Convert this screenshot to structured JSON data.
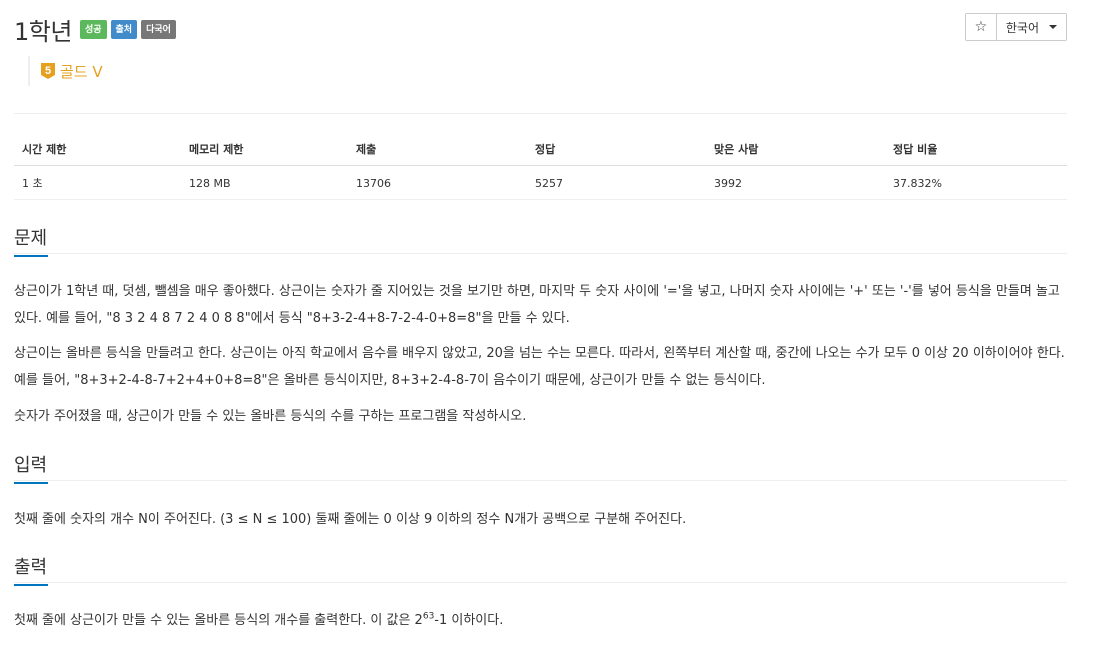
{
  "problem": {
    "title": "1학년",
    "labels": [
      "성공",
      "출처",
      "다국어"
    ],
    "tier_number": "5",
    "tier": "골드 V"
  },
  "controls": {
    "star": "☆",
    "language": "한국어"
  },
  "info_table": {
    "headers": [
      "시간 제한",
      "메모리 제한",
      "제출",
      "정답",
      "맞은 사람",
      "정답 비율"
    ],
    "row": [
      "1 초",
      "128 MB",
      "13706",
      "5257",
      "3992",
      "37.832%"
    ]
  },
  "sections": {
    "problem": {
      "heading": "문제",
      "paragraphs": [
        "상근이가 1학년 때, 덧셈, 뺄셈을 매우 좋아했다. 상근이는 숫자가 줄 지어있는 것을 보기만 하면, 마지막 두 숫자 사이에 '='을 넣고, 나머지 숫자 사이에는 '+' 또는 '-'를 넣어 등식을 만들며 놀고 있다. 예를 들어, \"8 3 2 4 8 7 2 4 0 8 8\"에서 등식 \"8+3-2-4+8-7-2-4-0+8=8\"을 만들 수 있다.",
        "상근이는 올바른 등식을 만들려고 한다. 상근이는 아직 학교에서 음수를 배우지 않았고, 20을 넘는 수는 모른다. 따라서, 왼쪽부터 계산할 때, 중간에 나오는 수가 모두 0 이상 20 이하이어야 한다. 예를 들어, \"8+3+2-4-8-7+2+4+0+8=8\"은 올바른 등식이지만, 8+3+2-4-8-7이 음수이기 때문에, 상근이가 만들 수 없는 등식이다.",
        "숫자가 주어졌을 때, 상근이가 만들 수 있는 올바른 등식의 수를 구하는 프로그램을 작성하시오."
      ]
    },
    "input": {
      "heading": "입력",
      "text": "첫째 줄에 숫자의 개수 N이 주어진다. (3 ≤ N ≤ 100) 둘째 줄에는 0 이상 9 이하의 정수 N개가 공백으로 구분해 주어진다."
    },
    "output": {
      "heading": "출력",
      "text_before": "첫째 줄에 상근이가 만들 수 있는 올바른 등식의 개수를 출력한다. 이 값은 2",
      "exponent": "63",
      "text_after": "-1 이하이다."
    }
  }
}
